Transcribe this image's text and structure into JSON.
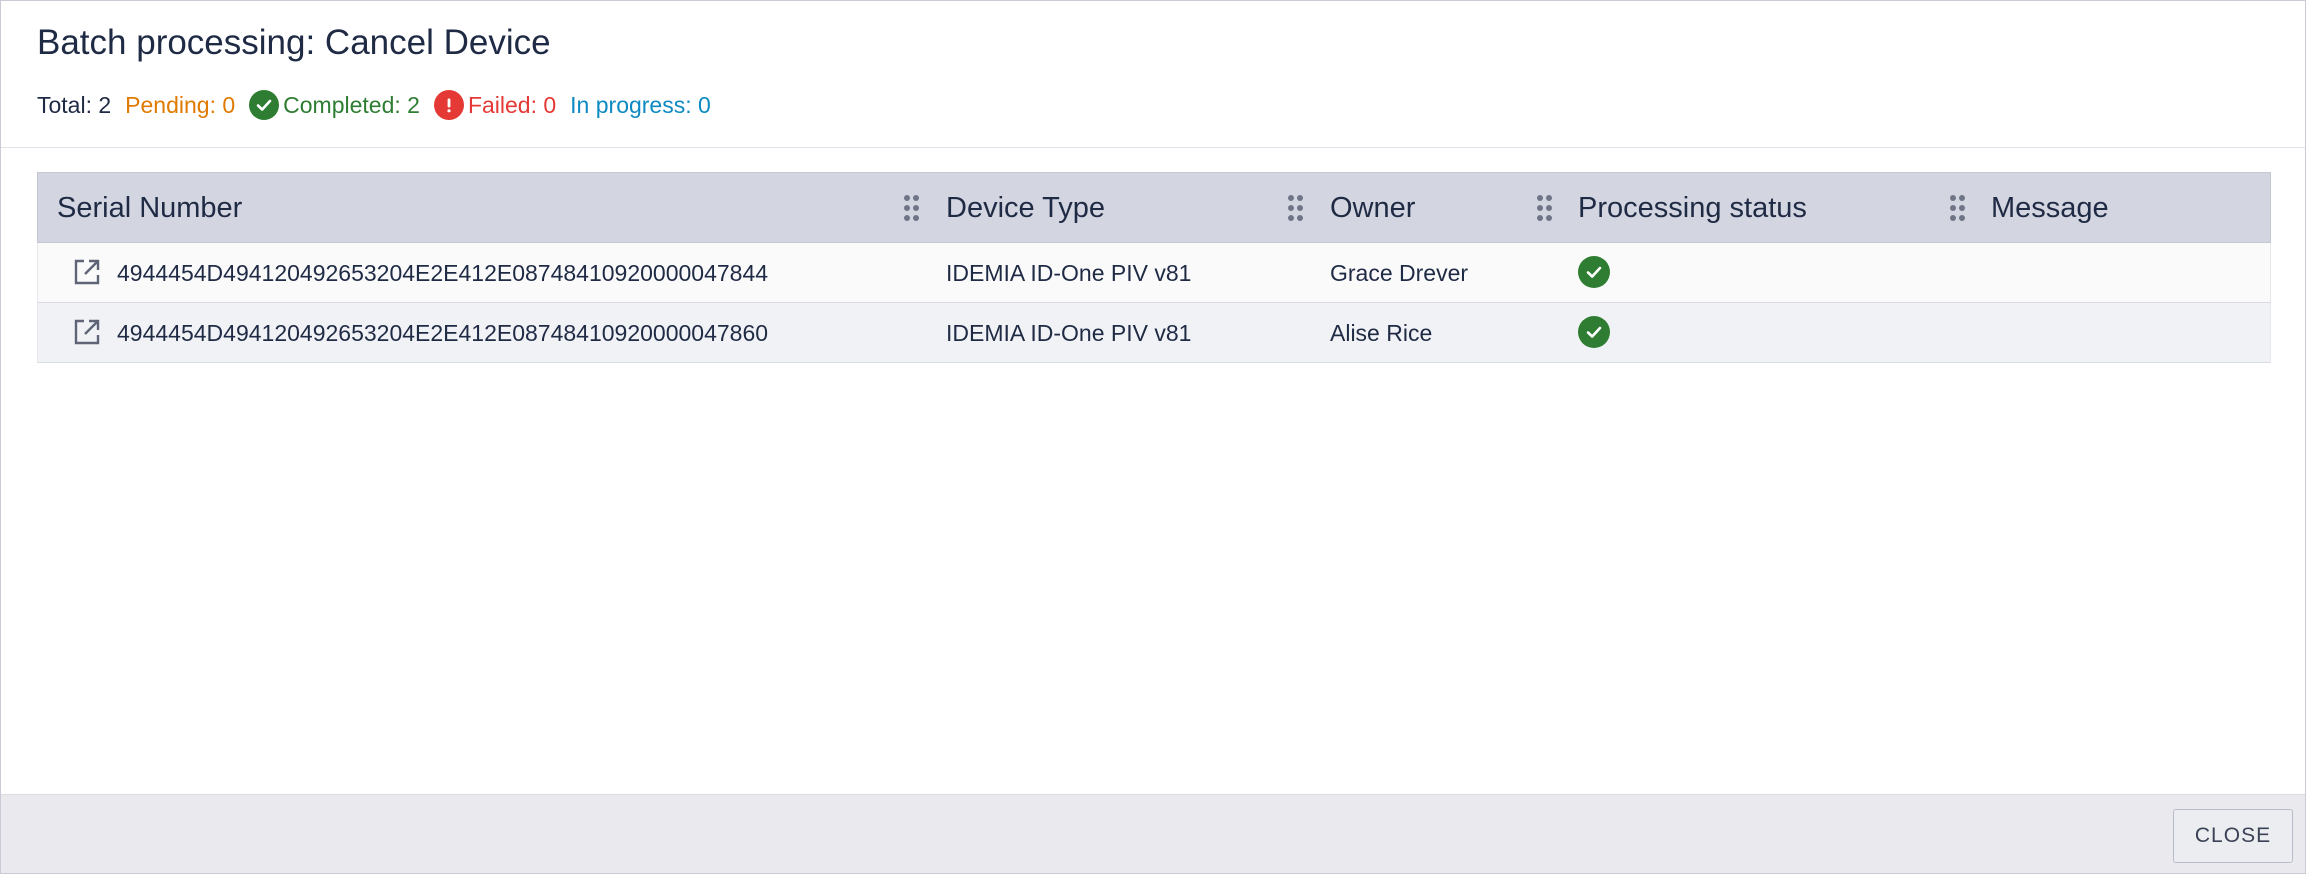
{
  "dialog": {
    "title": "Batch processing: Cancel Device",
    "summary": {
      "total": "Total: 2",
      "pending": "Pending: 0",
      "completed": "Completed: 2",
      "failed": "Failed: 0",
      "in_progress": "In progress: 0"
    }
  },
  "table": {
    "columns": [
      "Serial Number",
      "Device Type",
      "Owner",
      "Processing status",
      "Message"
    ],
    "rows": [
      {
        "serial": "4944454D494120492653204E2E412E08748410920000047844",
        "device_type": "IDEMIA ID-One PIV v81",
        "owner": "Grace Drever",
        "status_icon": "check-circle-icon",
        "message": ""
      },
      {
        "serial": "4944454D494120492653204E2E412E08748410920000047860",
        "device_type": "IDEMIA ID-One PIV v81",
        "owner": "Alise Rice",
        "status_icon": "check-circle-icon",
        "message": ""
      }
    ]
  },
  "footer": {
    "close_label": "CLOSE"
  },
  "colors": {
    "pending": "#e07a00",
    "completed": "#2e7d32",
    "failed": "#e53935",
    "in_progress": "#0d8ac2",
    "header_bg": "#d3d6e0"
  }
}
